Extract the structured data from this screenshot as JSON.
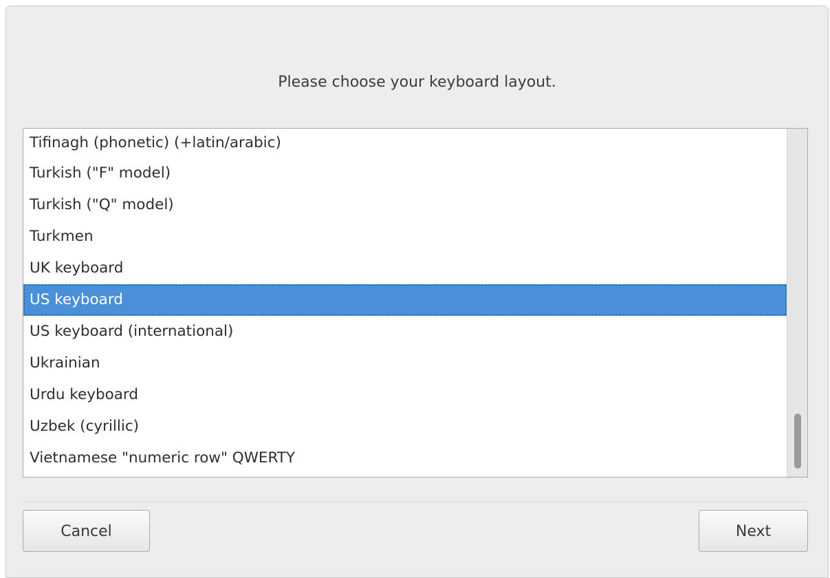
{
  "dialog": {
    "prompt": "Please choose your keyboard layout."
  },
  "layout_list": {
    "items": [
      "Tifinagh (phonetic) (+latin/arabic)",
      "Turkish (\"F\" model)",
      "Turkish (\"Q\" model)",
      "Turkmen",
      "UK keyboard",
      "US keyboard",
      "US keyboard (international)",
      "Ukrainian",
      "Urdu keyboard",
      "Uzbek (cyrillic)",
      "Vietnamese \"numeric row\" QWERTY"
    ],
    "selected": "US keyboard"
  },
  "buttons": {
    "cancel_label": "Cancel",
    "next_label": "Next"
  }
}
